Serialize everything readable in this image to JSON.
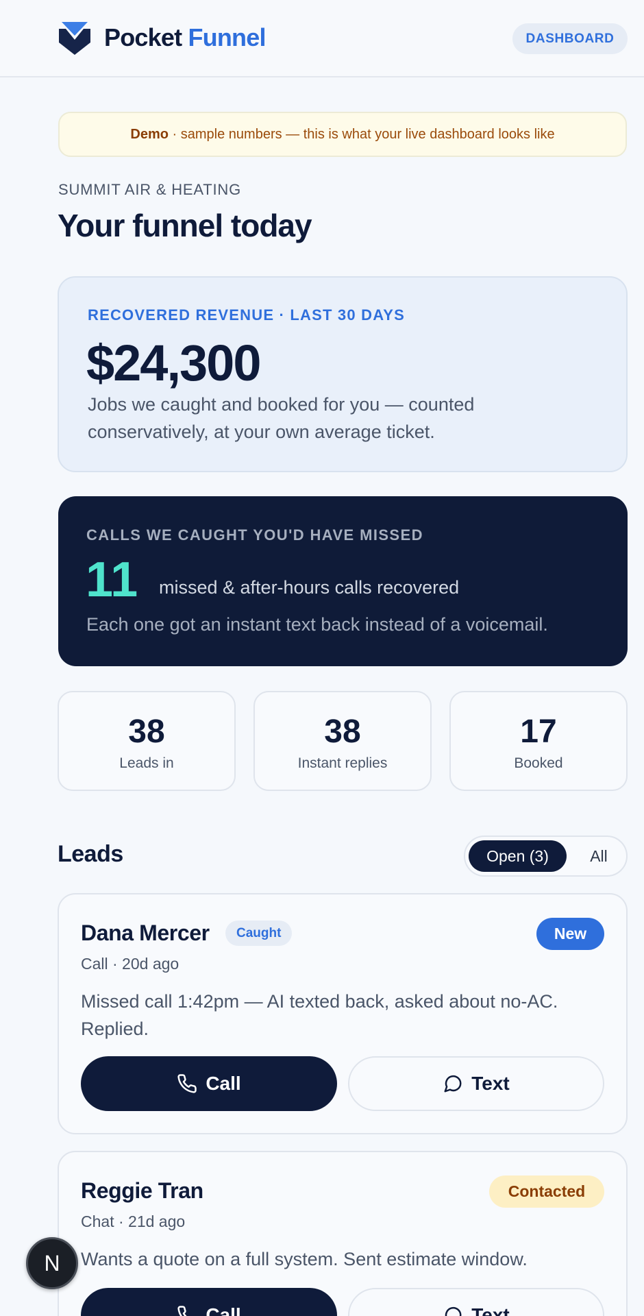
{
  "header": {
    "brand_primary": "Pocket",
    "brand_accent": "Funnel",
    "dashboard_button": "DASHBOARD",
    "logo_icon": "funnel-chevron-icon"
  },
  "demo_banner": {
    "label": "Demo",
    "text": " · sample numbers — this is what your live dashboard looks like"
  },
  "company": "SUMMIT AIR & HEATING",
  "page_title": "Your funnel today",
  "revenue": {
    "kicker": "RECOVERED REVENUE · LAST 30 DAYS",
    "value": "$24,300",
    "description": "Jobs we caught and booked for you — counted conservatively, at your own average ticket."
  },
  "calls": {
    "kicker": "CALLS WE CAUGHT YOU'D HAVE MISSED",
    "count": "11",
    "label": "missed & after-hours calls recovered",
    "description": "Each one got an instant text back instead of a voicemail."
  },
  "stats": [
    {
      "value": "38",
      "label": "Leads in"
    },
    {
      "value": "38",
      "label": "Instant replies"
    },
    {
      "value": "17",
      "label": "Booked"
    }
  ],
  "leads_section": {
    "title": "Leads",
    "filter_open": "Open (3)",
    "filter_all": "All"
  },
  "leads": [
    {
      "name": "Dana Mercer",
      "tag": "Caught",
      "status": "New",
      "meta": "Call · 20d ago",
      "note": "Missed call 1:42pm — AI texted back, asked about no-AC. Replied.",
      "call_label": "Call",
      "text_label": "Text"
    },
    {
      "name": "Reggie Tran",
      "status": "Contacted",
      "meta": "Chat · 21d ago",
      "note": "Wants a quote on a full system. Sent estimate window.",
      "call_label": "Call",
      "text_label": "Text"
    }
  ],
  "fab": {
    "label": "N"
  },
  "colors": {
    "navy": "#0f1b3a",
    "accent_blue": "#2f6fdc",
    "teal": "#4fe3cc",
    "amber_text": "#8a3d05"
  }
}
